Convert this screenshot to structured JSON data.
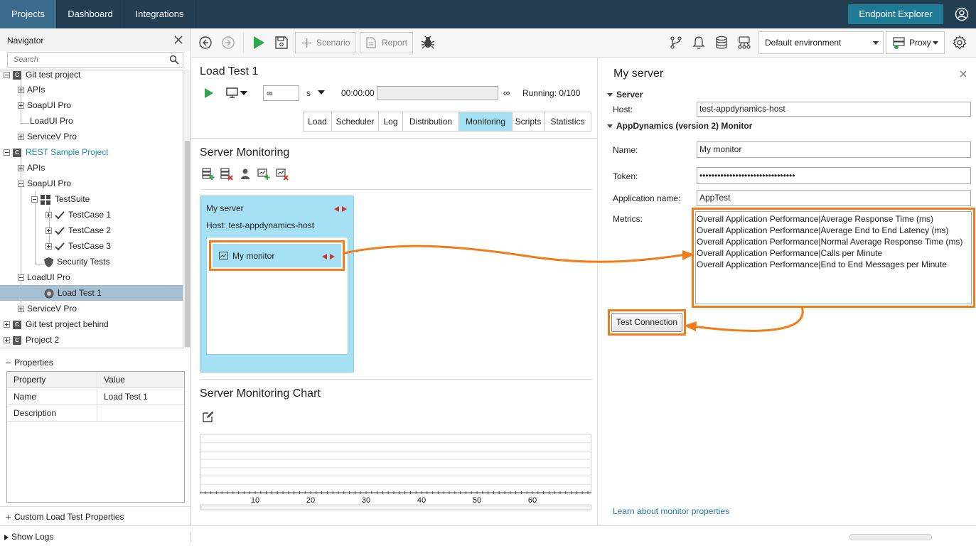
{
  "topbar": {
    "tabs": [
      {
        "label": "Projects",
        "active": true
      },
      {
        "label": "Dashboard",
        "active": false
      },
      {
        "label": "Integrations",
        "active": false
      }
    ],
    "endpoint_explorer": "Endpoint Explorer",
    "colors": {
      "bar": "#233d52",
      "active_tab": "#3a6a8c",
      "endpoint_button": "#1f7a96"
    }
  },
  "navigator": {
    "title": "Navigator",
    "search_placeholder": "Search",
    "tree": [
      {
        "label": "Git test project",
        "icon": "project-icon"
      },
      {
        "label": "APIs",
        "icon": "expand-plus-icon"
      },
      {
        "label": "SoapUI Pro",
        "icon": "expand-plus-icon"
      },
      {
        "label": "LoadUI Pro"
      },
      {
        "label": "ServiceV Pro",
        "icon": "expand-plus-icon"
      },
      {
        "label": "REST Sample Project",
        "icon": "project-icon",
        "highlight": true
      },
      {
        "label": "APIs",
        "icon": "expand-plus-icon"
      },
      {
        "label": "SoapUI Pro",
        "icon": "collapse-minus-icon"
      },
      {
        "label": "TestSuite",
        "icon": "testsuite-icon"
      },
      {
        "label": "TestCase 1",
        "icon": "check-icon"
      },
      {
        "label": "TestCase 2",
        "icon": "check-icon"
      },
      {
        "label": "TestCase 3",
        "icon": "check-icon"
      },
      {
        "label": "Security Tests",
        "icon": "shield-icon"
      },
      {
        "label": "LoadUI Pro",
        "icon": "collapse-minus-icon"
      },
      {
        "label": "Load Test 1",
        "icon": "gauge-icon",
        "selected": true
      },
      {
        "label": "ServiceV Pro",
        "icon": "expand-plus-icon"
      },
      {
        "label": "Git test project behind",
        "icon": "project-icon"
      },
      {
        "label": "Project 2",
        "icon": "project-icon"
      }
    ]
  },
  "properties": {
    "title": "Properties",
    "columns": [
      "Property",
      "Value"
    ],
    "rows": [
      {
        "property": "Name",
        "value": "Load Test 1"
      },
      {
        "property": "Description",
        "value": ""
      }
    ]
  },
  "custom_props": "Custom Load Test Properties",
  "statusbar": {
    "show_logs": "Show Logs"
  },
  "toolbar": {
    "scenario": "Scenario",
    "report": "Report",
    "environment": "Default environment",
    "proxy": "Proxy"
  },
  "loadtest": {
    "title": "Load Test 1",
    "duration_value": "∞",
    "duration_unit": "s",
    "elapsed": "00:00:00",
    "infinity": "∞",
    "running": "Running: 0/100",
    "tabs": [
      "Load",
      "Scheduler",
      "Log",
      "Distribution",
      "Monitoring",
      "Scripts",
      "Statistics"
    ],
    "active_tab": "Monitoring"
  },
  "server_monitoring": {
    "title": "Server Monitoring",
    "server": {
      "name": "My server",
      "host_line": "Host: test-appdynamics-host"
    },
    "monitor": {
      "name": "My monitor"
    }
  },
  "chart_section": {
    "title": "Server Monitoring Chart"
  },
  "chart_data": {
    "type": "line",
    "x_ticks": [
      10,
      20,
      30,
      40,
      50,
      60
    ],
    "series": [],
    "grid": true
  },
  "right_panel": {
    "title": "My server",
    "server_section": "Server",
    "host_label": "Host:",
    "host_value": "test-appdynamics-host",
    "monitor_section": "AppDynamics (version 2) Monitor",
    "name_label": "Name:",
    "name_value": "My monitor",
    "token_label": "Token:",
    "token_value": "••••••••••••••••••••••••••••••••",
    "app_label": "Application name:",
    "app_value": "AppTest",
    "metrics_label": "Metrics:",
    "metrics": [
      "Overall Application Performance|Average Response Time (ms)",
      "Overall Application Performance|Average End to End Latency (ms)",
      "Overall Application Performance|Normal Average Response Time (ms)",
      "Overall Application Performance|Calls per Minute",
      "Overall Application Performance|End to End Messages per Minute"
    ],
    "test_connection": "Test Connection",
    "learn_link": "Learn about monitor properties",
    "highlight_color": "#f07d1a"
  }
}
